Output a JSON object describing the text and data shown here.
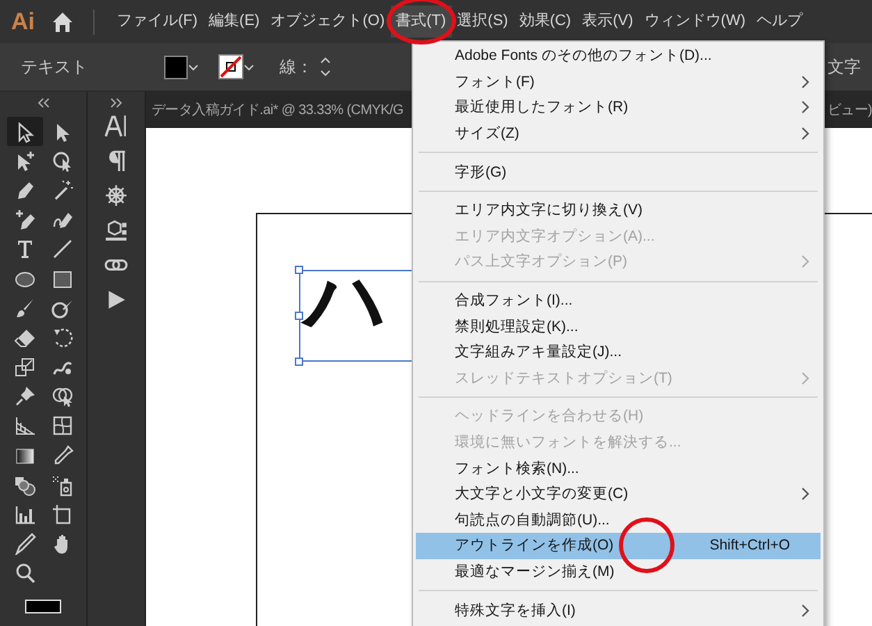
{
  "logo": "Ai",
  "menu_bar": [
    {
      "label": "ファイル(F)",
      "selected": false,
      "circled": false
    },
    {
      "label": "編集(E)",
      "selected": false,
      "circled": false
    },
    {
      "label": "オブジェクト(O)",
      "selected": false,
      "circled": false
    },
    {
      "label": "書式(T)",
      "selected": true,
      "circled": true
    },
    {
      "label": "選択(S)",
      "selected": false,
      "circled": false
    },
    {
      "label": "効果(C)",
      "selected": false,
      "circled": false
    },
    {
      "label": "表示(V)",
      "selected": false,
      "circled": false
    },
    {
      "label": "ウィンドウ(W)",
      "selected": false,
      "circled": false
    },
    {
      "label": "ヘルプ",
      "selected": false,
      "circled": false
    }
  ],
  "control_bar": {
    "mode_label": "テキスト",
    "stroke_label": "線：",
    "right_label": "文字"
  },
  "document_tab": {
    "title": "データ入稿ガイド.ai* @ 33.33% (CMYK/G",
    "right_title": "ビュー)"
  },
  "tools": [
    {
      "selected": true
    },
    {
      "selected": false
    },
    {
      "selected": false
    },
    {
      "selected": false
    },
    {
      "selected": false
    },
    {
      "selected": false
    },
    {
      "selected": false
    },
    {
      "selected": false
    },
    {
      "selected": false
    },
    {
      "selected": false
    },
    {
      "selected": false
    },
    {
      "selected": false
    },
    {
      "selected": false
    },
    {
      "selected": false
    },
    {
      "selected": false
    },
    {
      "selected": false
    },
    {
      "selected": false
    },
    {
      "selected": false
    },
    {
      "selected": false
    },
    {
      "selected": false
    },
    {
      "selected": false
    },
    {
      "selected": false
    },
    {
      "selected": false
    },
    {
      "selected": false
    },
    {
      "selected": false
    },
    {
      "selected": false
    },
    {
      "selected": false
    },
    {
      "selected": false
    },
    {
      "selected": false
    },
    {
      "selected": false
    },
    {
      "selected": false
    }
  ],
  "canvas": {
    "text": "ハ"
  },
  "dropdown_menu": [
    {
      "kind": "item",
      "label": "Adobe Fonts のその他のフォント(D)...",
      "disabled": false,
      "submenu": false,
      "selected": false,
      "circled": false
    },
    {
      "kind": "item",
      "label": "フォント(F)",
      "disabled": false,
      "submenu": true,
      "selected": false,
      "circled": false
    },
    {
      "kind": "item",
      "label": "最近使用したフォント(R)",
      "disabled": false,
      "submenu": true,
      "selected": false,
      "circled": false
    },
    {
      "kind": "item",
      "label": "サイズ(Z)",
      "disabled": false,
      "submenu": true,
      "selected": false,
      "circled": false
    },
    {
      "kind": "separator"
    },
    {
      "kind": "item",
      "label": "字形(G)",
      "disabled": false,
      "submenu": false,
      "selected": false,
      "circled": false
    },
    {
      "kind": "separator"
    },
    {
      "kind": "item",
      "label": "エリア内文字に切り換え(V)",
      "disabled": false,
      "submenu": false,
      "selected": false,
      "circled": false
    },
    {
      "kind": "item",
      "label": "エリア内文字オプション(A)...",
      "disabled": true,
      "submenu": false,
      "selected": false,
      "circled": false
    },
    {
      "kind": "item",
      "label": "パス上文字オプション(P)",
      "disabled": true,
      "submenu": true,
      "selected": false,
      "circled": false
    },
    {
      "kind": "separator"
    },
    {
      "kind": "item",
      "label": "合成フォント(I)...",
      "disabled": false,
      "submenu": false,
      "selected": false,
      "circled": false
    },
    {
      "kind": "item",
      "label": "禁則処理設定(K)...",
      "disabled": false,
      "submenu": false,
      "selected": false,
      "circled": false
    },
    {
      "kind": "item",
      "label": "文字組みアキ量設定(J)...",
      "disabled": false,
      "submenu": false,
      "selected": false,
      "circled": false
    },
    {
      "kind": "item",
      "label": "スレッドテキストオプション(T)",
      "disabled": true,
      "submenu": true,
      "selected": false,
      "circled": false
    },
    {
      "kind": "separator"
    },
    {
      "kind": "item",
      "label": "ヘッドラインを合わせる(H)",
      "disabled": true,
      "submenu": false,
      "selected": false,
      "circled": false
    },
    {
      "kind": "item",
      "label": "環境に無いフォントを解決する...",
      "disabled": true,
      "submenu": false,
      "selected": false,
      "circled": false
    },
    {
      "kind": "item",
      "label": "フォント検索(N)...",
      "disabled": false,
      "submenu": false,
      "selected": false,
      "circled": false
    },
    {
      "kind": "item",
      "label": "大文字と小文字の変更(C)",
      "disabled": false,
      "submenu": true,
      "selected": false,
      "circled": false
    },
    {
      "kind": "item",
      "label": "句読点の自動調節(U)...",
      "disabled": false,
      "submenu": false,
      "selected": false,
      "circled": false
    },
    {
      "kind": "item",
      "label": "アウトラインを作成(O)",
      "shortcut": "Shift+Ctrl+O",
      "disabled": false,
      "submenu": false,
      "selected": true,
      "circled": true
    },
    {
      "kind": "item",
      "label": "最適なマージン揃え(M)",
      "disabled": false,
      "submenu": false,
      "selected": false,
      "circled": false
    },
    {
      "kind": "separator"
    },
    {
      "kind": "item",
      "label": "特殊文字を挿入(I)",
      "disabled": false,
      "submenu": true,
      "selected": false,
      "circled": false
    }
  ]
}
